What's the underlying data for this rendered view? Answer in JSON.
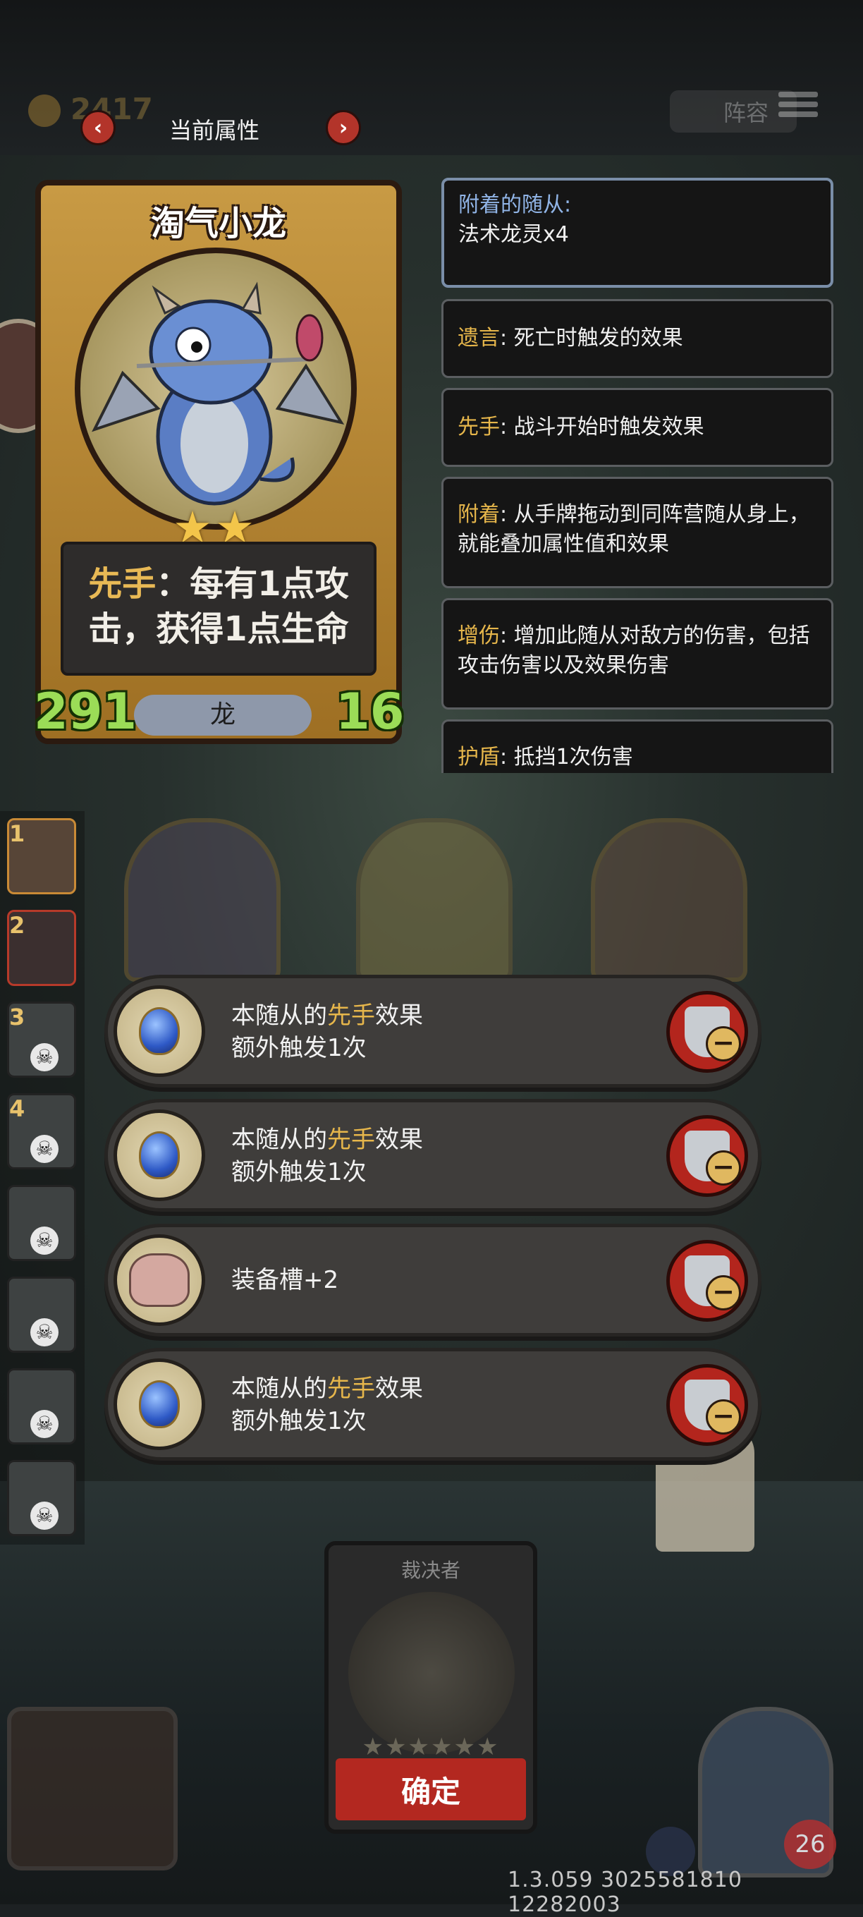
{
  "header": {
    "gold_value": "2417",
    "title": "当前属性",
    "lineup_label": "阵容"
  },
  "card": {
    "name": "淘气小龙",
    "desc_keyword": "先手",
    "desc_line1_rest": "：每有1点攻",
    "desc_line2": "击，获得1点生命",
    "attack": "291",
    "type": "龙",
    "health": "16",
    "stars": 2
  },
  "keywords": [
    {
      "term": "附着的随从:",
      "desc": "法术龙灵x4"
    },
    {
      "term": "遗言",
      "desc": ": 死亡时触发的效果"
    },
    {
      "term": "先手",
      "desc": ": 战斗开始时触发效果"
    },
    {
      "term": "附着",
      "desc": ": 从手牌拖动到同阵营随从身上，就能叠加属性值和效果"
    },
    {
      "term": "增伤",
      "desc": ": 增加此随从对敌方的伤害，包括攻击伤害以及效果伤害"
    },
    {
      "term": "护盾",
      "desc": ": 抵挡1次伤害"
    }
  ],
  "roster": [
    "1",
    "2",
    "3",
    "4",
    "",
    "",
    "",
    ""
  ],
  "effects": [
    {
      "icon": "blue-orb-icon",
      "line1_pre": "本随从的",
      "term": "先手",
      "line1_post": "效果",
      "line2": "额外触发1次"
    },
    {
      "icon": "blue-orb-icon",
      "line1_pre": "本随从的",
      "term": "先手",
      "line1_post": "效果",
      "line2": "额外触发1次"
    },
    {
      "icon": "pink-bag-icon",
      "text": "装备槽+2"
    },
    {
      "icon": "blue-orb-icon",
      "line1_pre": "本随从的",
      "term": "先手",
      "line1_post": "效果",
      "line2": "额外触发1次"
    }
  ],
  "confirm": {
    "card_title": "裁决者",
    "button_label": "确定"
  },
  "footer": {
    "hero_health": "26",
    "version": "1.3.059 3025581810 12282003"
  },
  "colors": {
    "keyword": "#e6b64b",
    "attached_keyword": "#90b4e6",
    "stat_green": "#9bdc57",
    "button_red": "#b32820"
  }
}
